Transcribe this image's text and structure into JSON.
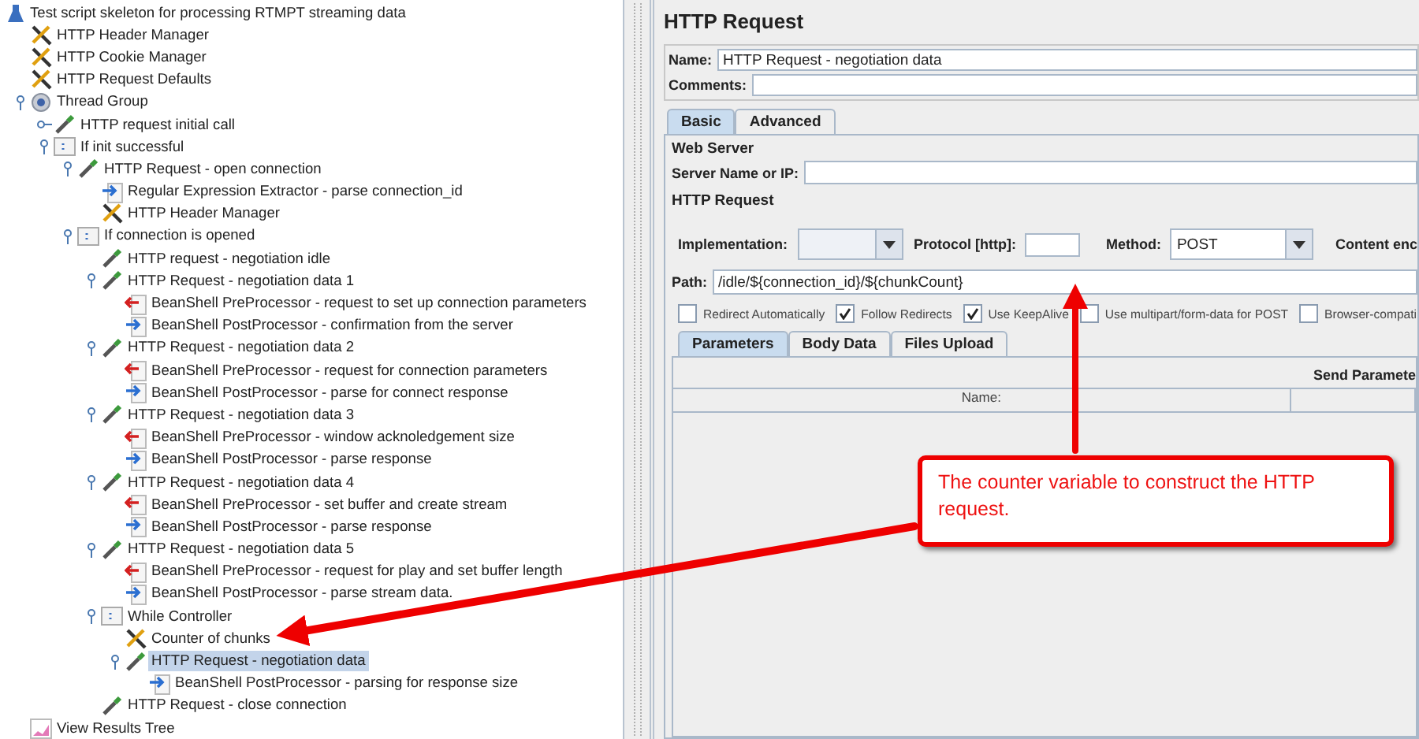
{
  "tree": [
    {
      "label": "Test script skeleton for processing RTMPT streaming data",
      "kind": "plan",
      "selected": false,
      "children": [
        {
          "label": "HTTP Header Manager",
          "kind": "config",
          "selected": false
        },
        {
          "label": "HTTP Cookie Manager",
          "kind": "config",
          "selected": false
        },
        {
          "label": "HTTP Request Defaults",
          "kind": "config",
          "selected": false
        },
        {
          "label": "Thread Group",
          "kind": "thread",
          "selected": false,
          "expanded": true,
          "children": [
            {
              "label": "HTTP request initial call",
              "kind": "sampler",
              "selected": false,
              "expanded": false
            },
            {
              "label": "If init successful",
              "kind": "controller",
              "selected": false,
              "expanded": true,
              "children": [
                {
                  "label": "HTTP Request - open connection",
                  "kind": "sampler",
                  "selected": false,
                  "expanded": true,
                  "children": [
                    {
                      "label": "Regular Expression Extractor - parse connection_id",
                      "kind": "post",
                      "selected": false
                    },
                    {
                      "label": "HTTP Header Manager",
                      "kind": "config",
                      "selected": false
                    }
                  ]
                },
                {
                  "label": "If connection is opened",
                  "kind": "controller",
                  "selected": false,
                  "expanded": true,
                  "children": [
                    {
                      "label": "HTTP request - negotiation idle",
                      "kind": "sampler",
                      "selected": false
                    },
                    {
                      "label": "HTTP Request - negotiation data 1",
                      "kind": "sampler",
                      "selected": false,
                      "expanded": true,
                      "children": [
                        {
                          "label": "BeanShell PreProcessor - request to set up connection parameters",
                          "kind": "pre",
                          "selected": false
                        },
                        {
                          "label": "BeanShell PostProcessor - confirmation from the server",
                          "kind": "post",
                          "selected": false
                        }
                      ]
                    },
                    {
                      "label": "HTTP Request - negotiation data 2",
                      "kind": "sampler",
                      "selected": false,
                      "expanded": true,
                      "children": [
                        {
                          "label": "BeanShell PreProcessor - request for connection parameters",
                          "kind": "pre",
                          "selected": false
                        },
                        {
                          "label": "BeanShell PostProcessor - parse for connect response",
                          "kind": "post",
                          "selected": false
                        }
                      ]
                    },
                    {
                      "label": "HTTP Request - negotiation data 3",
                      "kind": "sampler",
                      "selected": false,
                      "expanded": true,
                      "children": [
                        {
                          "label": "BeanShell PreProcessor - window acknoledgement size",
                          "kind": "pre",
                          "selected": false
                        },
                        {
                          "label": "BeanShell PostProcessor - parse response",
                          "kind": "post",
                          "selected": false
                        }
                      ]
                    },
                    {
                      "label": "HTTP Request - negotiation data 4",
                      "kind": "sampler",
                      "selected": false,
                      "expanded": true,
                      "children": [
                        {
                          "label": "BeanShell PreProcessor - set buffer and create stream",
                          "kind": "pre",
                          "selected": false
                        },
                        {
                          "label": "BeanShell PostProcessor - parse response",
                          "kind": "post",
                          "selected": false
                        }
                      ]
                    },
                    {
                      "label": "HTTP Request - negotiation data 5",
                      "kind": "sampler",
                      "selected": false,
                      "expanded": true,
                      "children": [
                        {
                          "label": "BeanShell PreProcessor - request for play and set buffer length",
                          "kind": "pre",
                          "selected": false
                        },
                        {
                          "label": "BeanShell PostProcessor - parse stream data.",
                          "kind": "post",
                          "selected": false
                        }
                      ]
                    },
                    {
                      "label": "While Controller",
                      "kind": "controller",
                      "selected": false,
                      "expanded": true,
                      "children": [
                        {
                          "label": "Counter of chunks",
                          "kind": "config",
                          "selected": false
                        },
                        {
                          "label": "HTTP Request - negotiation data",
                          "kind": "sampler",
                          "selected": true,
                          "expanded": true,
                          "children": [
                            {
                              "label": "BeanShell PostProcessor - parsing for response size",
                              "kind": "post",
                              "selected": false
                            }
                          ]
                        }
                      ]
                    },
                    {
                      "label": "HTTP Request - close connection",
                      "kind": "sampler",
                      "selected": false
                    }
                  ]
                }
              ]
            }
          ]
        },
        {
          "label": "View Results Tree",
          "kind": "listener",
          "selected": false
        }
      ]
    }
  ],
  "editor": {
    "title": "HTTP Request",
    "name_label": "Name:",
    "name_value": "HTTP Request - negotiation data",
    "comments_label": "Comments:",
    "tabs": [
      {
        "label": "Basic",
        "selected": true
      },
      {
        "label": "Advanced",
        "selected": false
      }
    ],
    "web_server": {
      "legend": "Web Server",
      "server_label": "Server Name or IP:"
    },
    "http_request": {
      "legend": "HTTP Request",
      "implementation_label": "Implementation:",
      "protocol_label": "Protocol [http]:",
      "method_label": "Method:",
      "method_value": "POST",
      "content_encoding_label": "Content enc",
      "path_label": "Path:",
      "path_value": "/idle/${connection_id}/${chunkCount}"
    },
    "options": [
      {
        "label": "Redirect Automatically",
        "checked": false
      },
      {
        "label": "Follow Redirects",
        "checked": true
      },
      {
        "label": "Use KeepAlive",
        "checked": true
      },
      {
        "label": "Use multipart/form-data for POST",
        "checked": false
      },
      {
        "label": "Browser-compati",
        "checked": false
      }
    ],
    "subtabs": [
      {
        "label": "Parameters",
        "selected": true
      },
      {
        "label": "Body Data",
        "selected": false
      },
      {
        "label": "Files Upload",
        "selected": false
      }
    ],
    "parameters": {
      "heading": "Send Paramete",
      "columns": [
        "Name:"
      ]
    }
  },
  "callout": {
    "text": "The counter variable to construct the HTTP request."
  }
}
